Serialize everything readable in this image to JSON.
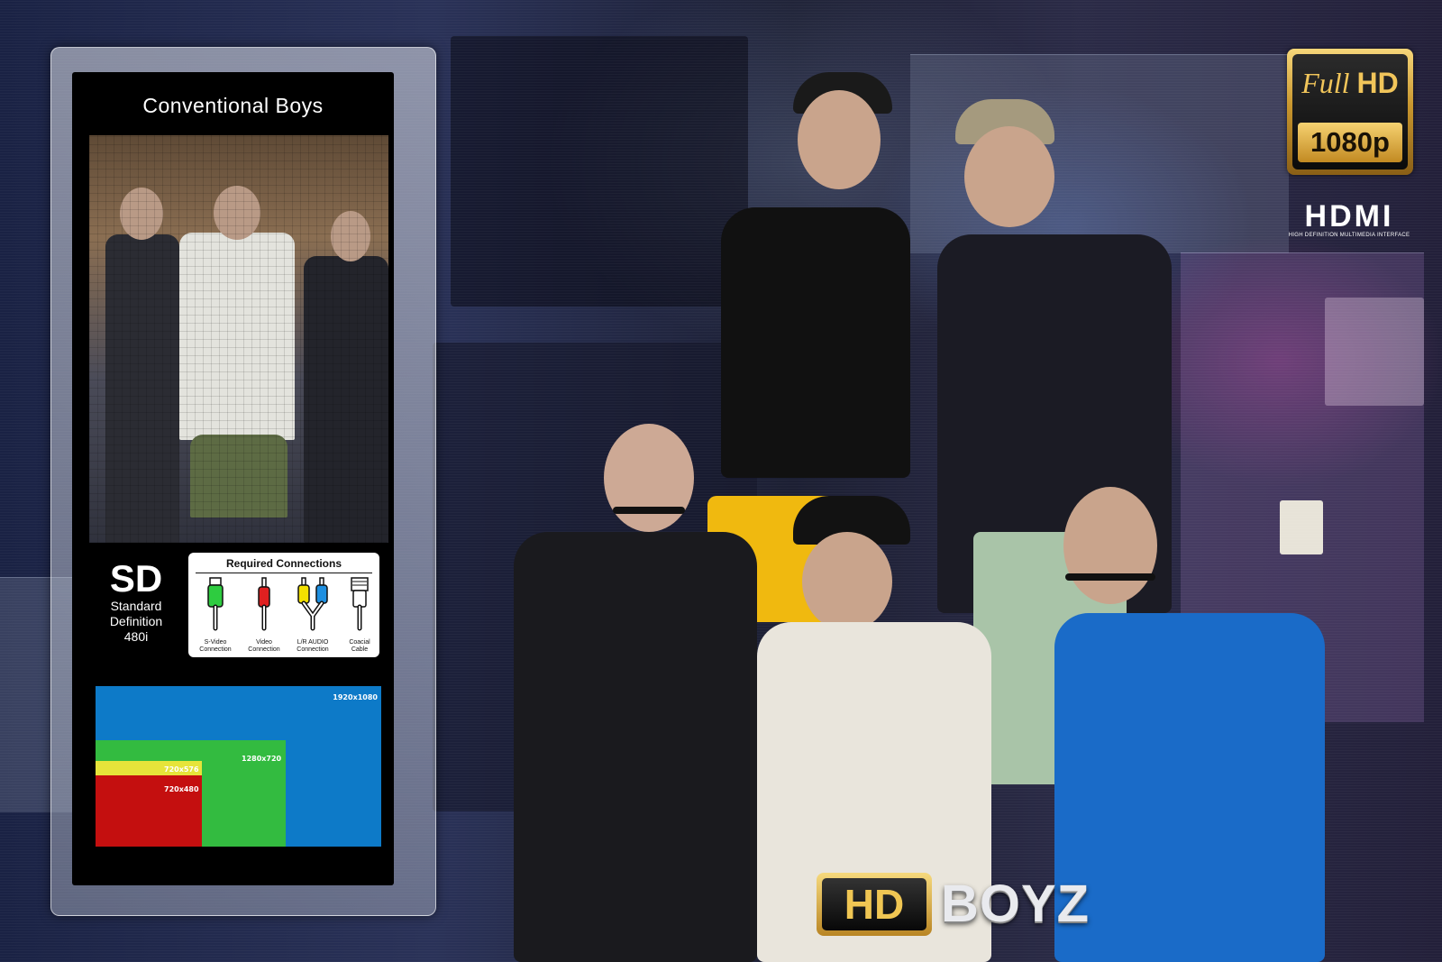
{
  "panel": {
    "title": "Conventional Boys",
    "sd": {
      "big": "SD",
      "line1": "Standard",
      "line2": "Definition",
      "line3": "480i"
    },
    "connections": {
      "title": "Required Connections",
      "items": [
        {
          "line1": "S-Video",
          "line2": "Connection",
          "icon": "s-video-cable-icon",
          "color": "#2ecc40"
        },
        {
          "line1": "Video",
          "line2": "Connection",
          "icon": "video-cable-icon",
          "color": "#e02020"
        },
        {
          "line1": "L/R AUDIO",
          "line2": "Connection",
          "icon": "audio-cable-icon",
          "color": "#f2e000"
        },
        {
          "line1": "Coacial",
          "line2": "Cable",
          "icon": "coaxial-cable-icon",
          "color": "#ffffff"
        }
      ]
    },
    "resolutions": [
      {
        "label": "1920x1080",
        "color": "#0d7ac8"
      },
      {
        "label": "1280x720",
        "color": "#33bb40"
      },
      {
        "label": "720x576",
        "color": "#e6e43a"
      },
      {
        "label": "720x480",
        "color": "#c40f0f"
      }
    ]
  },
  "badges": {
    "fullhd_top_a": "Full",
    "fullhd_top_b": "HD",
    "fullhd_bottom": "1080p",
    "hdmi_logo": "HDMI",
    "hdmi_sub": "HIGH DEFINITION MULTIMEDIA INTERFACE"
  },
  "logo": {
    "hd": "HD",
    "boyz": "BOYZ"
  }
}
